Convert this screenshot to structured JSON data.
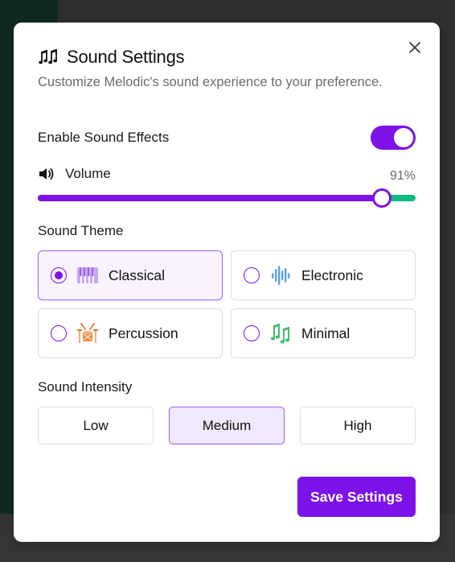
{
  "dialog": {
    "title": "Sound Settings",
    "title_icon": "music-notes-icon",
    "subtitle": "Customize Melodic's sound experience to your preference.",
    "close_icon": "close-icon"
  },
  "sound_effects": {
    "label": "Enable Sound Effects",
    "enabled": true
  },
  "volume": {
    "label": "Volume",
    "icon": "speaker-icon",
    "value": 91,
    "value_text": "91%"
  },
  "sound_theme": {
    "label": "Sound Theme",
    "options": [
      {
        "label": "Classical",
        "icon": "piano-keys-icon",
        "selected": true
      },
      {
        "label": "Electronic",
        "icon": "waveform-icon",
        "selected": false
      },
      {
        "label": "Percussion",
        "icon": "drum-icon",
        "selected": false
      },
      {
        "label": "Minimal",
        "icon": "music-notes-icon",
        "selected": false
      }
    ]
  },
  "sound_intensity": {
    "label": "Sound Intensity",
    "options": [
      "Low",
      "Medium",
      "High"
    ],
    "selected": "Medium"
  },
  "save_label": "Save Settings",
  "colors": {
    "accent": "#7c12e8",
    "track_remaining": "#10b981",
    "selected_bg": "#f8f3fe",
    "background_panel": "#10291e"
  }
}
